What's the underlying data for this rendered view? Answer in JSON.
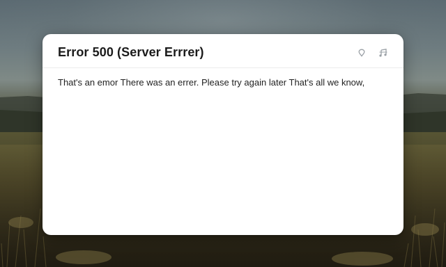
{
  "dialog": {
    "title": "Error 500 (Server Errrer)",
    "message": "That's an emor There was an errer. Please try again later That's all we know,",
    "icons": [
      "pin-icon",
      "media-icon"
    ]
  },
  "colors": {
    "dialog_background": "#ffffff",
    "title_text": "#1b1b1b",
    "body_text": "#222222",
    "icon": "#9aa0a6"
  }
}
